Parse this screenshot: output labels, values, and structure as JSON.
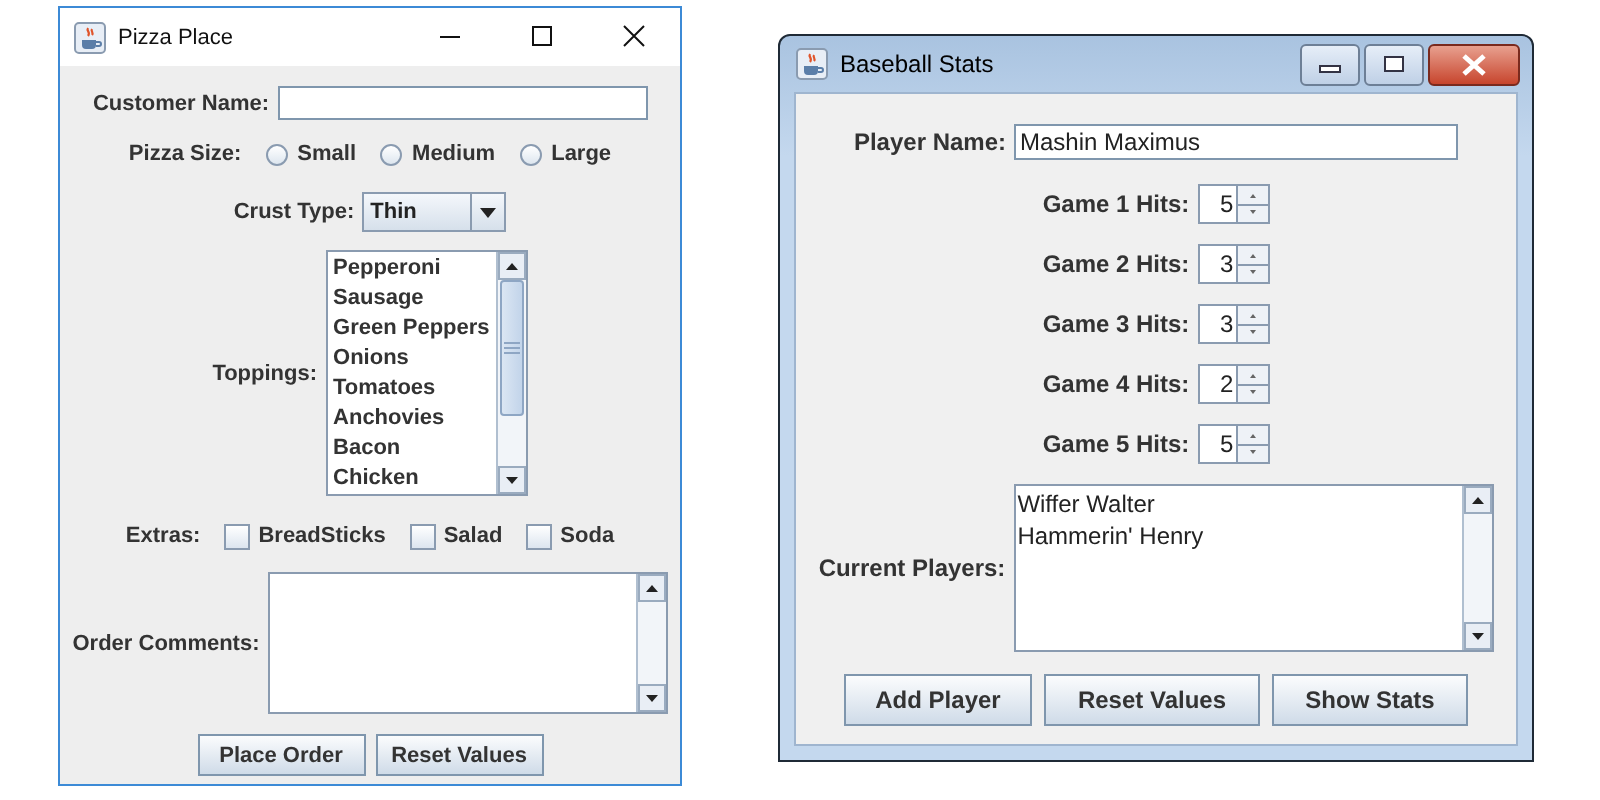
{
  "pizza_window": {
    "title": "Pizza Place",
    "customer_name": {
      "label": "Customer Name:"
    },
    "pizza_size": {
      "label": "Pizza Size:",
      "options": [
        {
          "label": "Small",
          "selected": false
        },
        {
          "label": "Medium",
          "selected": false
        },
        {
          "label": "Large",
          "selected": false
        }
      ]
    },
    "crust_type": {
      "label": "Crust Type:",
      "value": "Thin"
    },
    "toppings": {
      "label": "Toppings:",
      "items": [
        {
          "label": "Pepperoni",
          "selected": false
        },
        {
          "label": "Sausage",
          "selected": false
        },
        {
          "label": "Green Peppers",
          "selected": false
        },
        {
          "label": "Onions",
          "selected": false
        },
        {
          "label": "Tomatoes",
          "selected": false
        },
        {
          "label": "Anchovies",
          "selected": false
        },
        {
          "label": "Bacon",
          "selected": false
        },
        {
          "label": "Chicken",
          "selected": false
        }
      ]
    },
    "extras": {
      "label": "Extras:",
      "options": [
        {
          "label": "BreadSticks",
          "checked": false
        },
        {
          "label": "Salad",
          "checked": false
        },
        {
          "label": "Soda",
          "checked": false
        }
      ]
    },
    "order_comments": {
      "label": "Order Comments:"
    },
    "buttons": [
      "Place Order",
      "Reset Values"
    ]
  },
  "baseball_window": {
    "title": "Baseball Stats",
    "player_name": {
      "label": "Player Name:",
      "value": "Mashin Maximus"
    },
    "games": [
      {
        "label": "Game 1 Hits:",
        "value": "5"
      },
      {
        "label": "Game 2 Hits:",
        "value": "3"
      },
      {
        "label": "Game 3 Hits:",
        "value": "3"
      },
      {
        "label": "Game 4 Hits:",
        "value": "2"
      },
      {
        "label": "Game 5 Hits:",
        "value": "5"
      }
    ],
    "current_players": {
      "label": "Current Players:",
      "items": [
        {
          "label": "Wiffer Walter",
          "selected": false
        },
        {
          "label": "Hammerin' Henry",
          "selected": false
        }
      ]
    },
    "buttons": [
      "Add Player",
      "Reset Values",
      "Show Stats"
    ]
  }
}
